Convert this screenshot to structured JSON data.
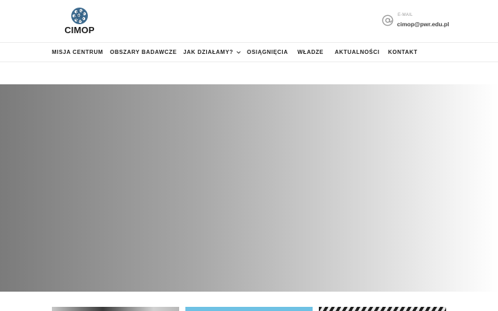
{
  "brand": {
    "name": "CIMOP"
  },
  "contact": {
    "label": "E-MAIL",
    "value": "cimop@pwr.edu.pl"
  },
  "nav": {
    "items": [
      {
        "label": "MISJA CENTRUM"
      },
      {
        "label": "OBSZARY BADAWCZE"
      },
      {
        "label": "JAK DZIAŁAMY?",
        "has_dropdown": true
      },
      {
        "label": "OSIĄGNIĘCIA"
      },
      {
        "label": "WŁADZE"
      },
      {
        "label": "AKTUALNOŚCI"
      },
      {
        "label": "KONTAKT"
      }
    ]
  },
  "colors": {
    "logo_blue": "#3d6b8f",
    "card_blue": "#6ec1e4"
  }
}
